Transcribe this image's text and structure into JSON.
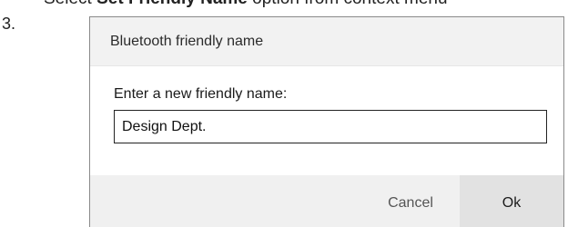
{
  "instruction": {
    "prefix": "Select ",
    "bold_text": "Set Friendly Name",
    "suffix": " option from context menu"
  },
  "step_number": "3.",
  "dialog": {
    "title": "Bluetooth friendly name",
    "prompt_label": "Enter a new friendly name:",
    "name_value": "Design Dept.",
    "cancel_label": "Cancel",
    "ok_label": "Ok"
  }
}
